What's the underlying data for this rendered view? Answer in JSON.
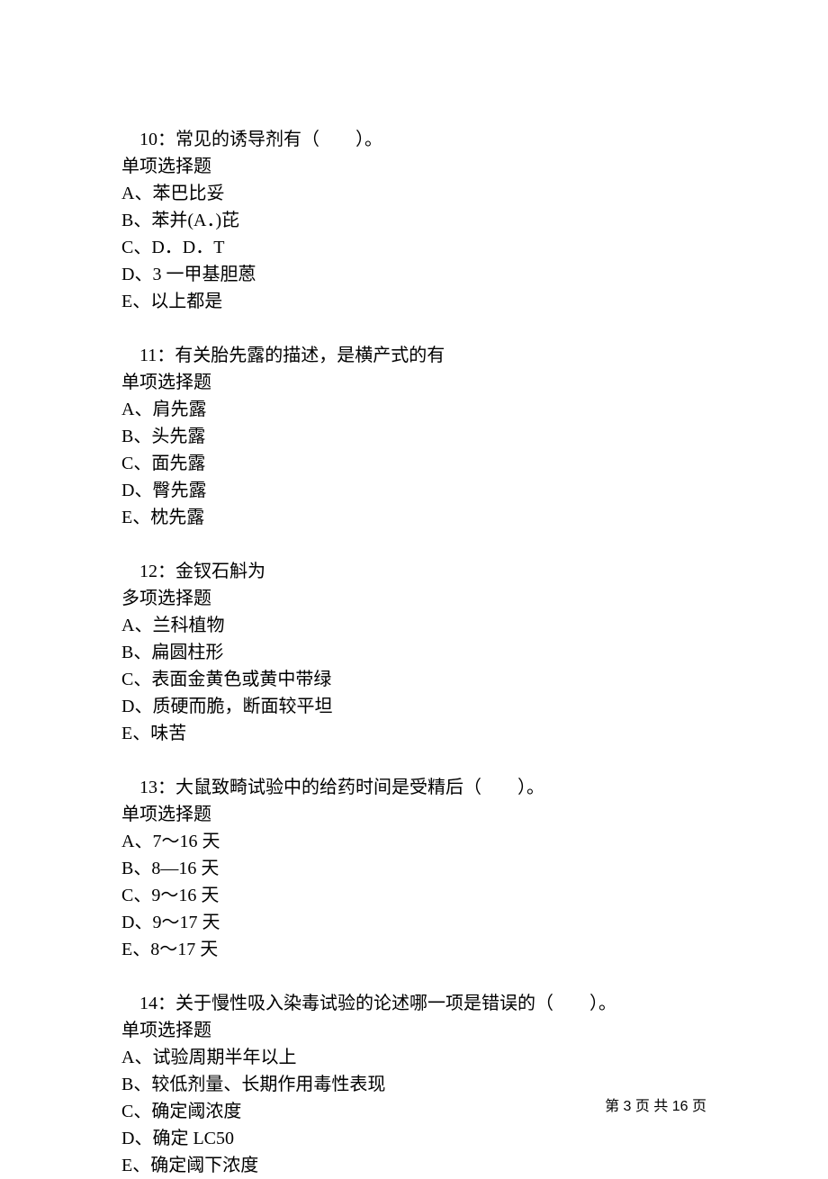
{
  "questions": [
    {
      "title": "10：常见的诱导剂有（　　）。",
      "type": "单项选择题",
      "options": [
        "A、苯巴比妥",
        "B、苯并(A．)芘",
        "C、D．D．T",
        "D、3 一甲基胆蒽",
        "E、以上都是"
      ]
    },
    {
      "title": "11：有关胎先露的描述，是横产式的有",
      "type": "单项选择题",
      "options": [
        "A、肩先露",
        "B、头先露",
        "C、面先露",
        "D、臀先露",
        "E、枕先露"
      ]
    },
    {
      "title": "12：金钗石斛为",
      "type": "多项选择题",
      "options": [
        "A、兰科植物",
        "B、扁圆柱形",
        "C、表面金黄色或黄中带绿",
        "D、质硬而脆，断面较平坦",
        "E、味苦"
      ]
    },
    {
      "title": "13：大鼠致畸试验中的给药时间是受精后（　　）。",
      "type": "单项选择题",
      "options": [
        "A、7～16 天",
        "B、8—16 天",
        "C、9～16 天",
        "D、9～17 天",
        "E、8～17 天"
      ]
    },
    {
      "title": "14：关于慢性吸入染毒试验的论述哪一项是错误的（　　）。",
      "type": "单项选择题",
      "options": [
        "A、试验周期半年以上",
        "B、较低剂量、长期作用毒性表现",
        "C、确定阈浓度",
        "D、确定 LC50",
        "E、确定阈下浓度"
      ]
    }
  ],
  "footer": "第 3 页 共 16 页"
}
